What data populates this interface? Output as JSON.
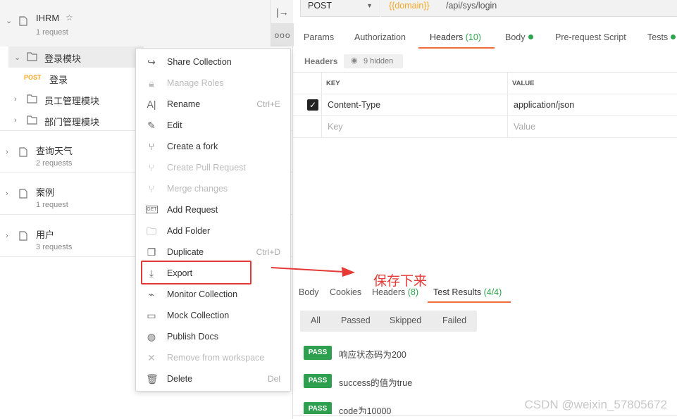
{
  "sidebar": {
    "collections": [
      {
        "name": "IHRM",
        "count": "1 request"
      },
      {
        "name": "查询天气",
        "count": "2 requests"
      },
      {
        "name": "案例",
        "count": "1 request"
      },
      {
        "name": "用户",
        "count": "3 requests"
      }
    ],
    "tree": {
      "folder_login": "登录模块",
      "request_method": "POST",
      "request_name": "登录",
      "folder_staff": "员工管理模块",
      "folder_dept": "部门管理模块"
    },
    "tools": {
      "collapse": "|→",
      "more": "ooo"
    }
  },
  "menu": {
    "items": [
      {
        "label": "Share Collection",
        "shortcut": "",
        "icon": "share-icon",
        "disabled": false
      },
      {
        "label": "Manage Roles",
        "shortcut": "",
        "icon": "lock-icon",
        "disabled": true
      },
      {
        "label": "Rename",
        "shortcut": "Ctrl+E",
        "icon": "rename-icon",
        "disabled": false
      },
      {
        "label": "Edit",
        "shortcut": "",
        "icon": "pencil-icon",
        "disabled": false
      },
      {
        "label": "Create a fork",
        "shortcut": "",
        "icon": "fork-icon",
        "disabled": false
      },
      {
        "label": "Create Pull Request",
        "shortcut": "",
        "icon": "pull-request-icon",
        "disabled": true
      },
      {
        "label": "Merge changes",
        "shortcut": "",
        "icon": "merge-icon",
        "disabled": true
      },
      {
        "label": "Add Request",
        "shortcut": "",
        "icon": "get-request-icon",
        "disabled": false
      },
      {
        "label": "Add Folder",
        "shortcut": "",
        "icon": "folder-add-icon",
        "disabled": false
      },
      {
        "label": "Duplicate",
        "shortcut": "Ctrl+D",
        "icon": "duplicate-icon",
        "disabled": false
      },
      {
        "label": "Export",
        "shortcut": "",
        "icon": "download-icon",
        "disabled": false
      },
      {
        "label": "Monitor Collection",
        "shortcut": "",
        "icon": "monitor-icon",
        "disabled": false
      },
      {
        "label": "Mock Collection",
        "shortcut": "",
        "icon": "server-icon",
        "disabled": false
      },
      {
        "label": "Publish Docs",
        "shortcut": "",
        "icon": "globe-icon",
        "disabled": false
      },
      {
        "label": "Remove from workspace",
        "shortcut": "",
        "icon": "close-icon",
        "disabled": true
      },
      {
        "label": "Delete",
        "shortcut": "Del",
        "icon": "trash-icon",
        "disabled": false
      }
    ]
  },
  "request": {
    "method": "POST",
    "url_var": "{{domain}}",
    "url_path": "/api/sys/login"
  },
  "tabs": {
    "params": "Params",
    "authorization": "Authorization",
    "headers": "Headers",
    "headers_count": "(10)",
    "body": "Body",
    "prerequest": "Pre-request Script",
    "tests": "Tests"
  },
  "headers_section": {
    "title": "Headers",
    "hidden": "9 hidden",
    "col_key": "KEY",
    "col_value": "VALUE",
    "rows": [
      {
        "key": "Content-Type",
        "value": "application/json"
      }
    ],
    "key_placeholder": "Key",
    "value_placeholder": "Value"
  },
  "response": {
    "tabs": {
      "body": "Body",
      "cookies": "Cookies",
      "headers": "Headers",
      "headers_count": "(8)",
      "test_results": "Test Results",
      "test_count": "(4/4)"
    },
    "filters": [
      "All",
      "Passed",
      "Skipped",
      "Failed"
    ],
    "results": [
      {
        "status": "PASS",
        "text": "响应状态码为200"
      },
      {
        "status": "PASS",
        "text": "success的值为true"
      },
      {
        "status": "PASS",
        "text": "code为10000"
      }
    ]
  },
  "annotation": "保存下来",
  "watermark": "CSDN @weixin_57805672",
  "colors": {
    "accent": "#f26b3a",
    "success": "#2d9f4f",
    "highlight": "#e53935",
    "variable": "#f5a623"
  }
}
